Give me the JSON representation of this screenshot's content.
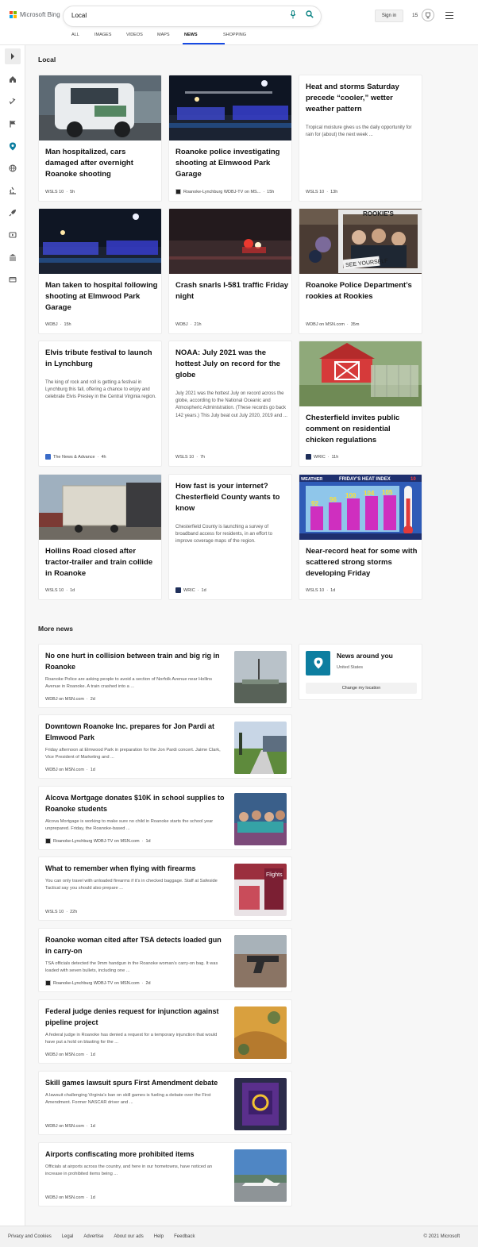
{
  "header": {
    "brand": "Microsoft Bing",
    "search_query": "Local",
    "sign_in": "Sign in",
    "points": "15",
    "tabs": [
      "ALL",
      "IMAGES",
      "VIDEOS",
      "MAPS",
      "NEWS",
      "SHOPPING"
    ],
    "active_tab": "NEWS",
    "accent_color": "#174ae4"
  },
  "sidebar": {
    "icons": [
      "expand-arrow-icon",
      "home-icon",
      "satellite-icon",
      "flag-icon",
      "location-pin-icon",
      "globe-icon",
      "microscope-icon",
      "rocket-icon",
      "video-icon",
      "bank-icon",
      "card-icon"
    ]
  },
  "local_section": {
    "title": "Local",
    "cards": [
      {
        "title": "Man hospitalized, cars damaged after overnight Roanoke shooting",
        "source": "WSLS 10",
        "age": "5h",
        "image": "police-car-photo"
      },
      {
        "title": "Roanoke police investigating shooting at Elmwood Park Garage",
        "source": "Roanoke-Lynchburg WDBJ-TV on MS...",
        "age": "15h",
        "image": "police-lights-night-photo"
      },
      {
        "title": "Heat and storms Saturday precede “cooler,” wetter weather pattern",
        "snippet": "Tropical moisture gives us the daily opportunity for rain for (about) the next week ...",
        "source": "WSLS 10",
        "age": "13h"
      },
      {
        "title": "Man taken to hospital following shooting at Elmwood Park Garage",
        "source": "WDBJ",
        "age": "15h",
        "image": "police-lights-night-photo"
      },
      {
        "title": "Crash snarls I-581 traffic Friday night",
        "source": "WDBJ",
        "age": "21h",
        "image": "highway-crash-night-photo"
      },
      {
        "title": "Roanoke Police Department’s rookies at Rookies",
        "source": "WDBJ on MSN.com",
        "age": "35m",
        "image": "rookies-frame-photo",
        "image_text": [
          "ROOKIE'S",
          "SEE YOURSELF"
        ]
      },
      {
        "title": "Elvis tribute festival to launch in Lynchburg",
        "snippet": "The king of rock and roll is getting a festival in Lynchburg this fall, offering a chance to enjoy and celebrate Elvis Presley in the Central Virginia region.",
        "source": "The News & Advance",
        "age": "4h"
      },
      {
        "title": "NOAA: July 2021 was the hottest July on record for the globe",
        "snippet": "July 2021 was the hottest July on record across the globe, according to the National Oceanic and Atmospheric Administration. (These records go back 142 years.) This July beat out July 2020, 2019 and ...",
        "source": "WSLS 10",
        "age": "7h"
      },
      {
        "title": "Chesterfield invites public comment on residential chicken regulations",
        "source": "WRIC",
        "age": "11h",
        "image": "red-chicken-coop-photo"
      },
      {
        "title": "Hollins Road closed after tractor-trailer and train collide in Roanoke",
        "source": "WSLS 10",
        "age": "1d",
        "image": "tractor-trailer-photo"
      },
      {
        "title": "How fast is your internet? Chesterfield County wants to know",
        "snippet": "Chesterfield County is launching a survey of broadband access for residents, in an effort to improve coverage maps of the region.",
        "source": "WRIC",
        "age": "1d"
      },
      {
        "title": "Near-record heat for some with scattered strong storms developing Friday",
        "source": "WSLS 10",
        "age": "1d",
        "image": "heat-index-graphic",
        "image_text": [
          "FRIDAY'S HEAT INDEX",
          "92",
          "96",
          "100",
          "104",
          "105",
          "WEATHER",
          "10"
        ]
      }
    ]
  },
  "more_news": {
    "title": "More news",
    "items": [
      {
        "title": "No one hurt in collision between train and big rig in Roanoke",
        "snippet": "Roanoke Police are asking people to avoid a section of Norfolk Avenue near Hollins Avenue in Roanoke. A train crashed into a ...",
        "source": "WDBJ on MSN.com",
        "age": "2d",
        "thumb": "overcast-road-photo"
      },
      {
        "title": "Downtown Roanoke Inc. prepares for Jon Pardi at Elmwood Park",
        "snippet": "Friday afternoon at Elmwood Park in preparation for the Jon Pardi concert. Jaime Clark, Vice President of Marketing and ...",
        "source": "WDBJ on MSN.com",
        "age": "1d",
        "thumb": "park-path-photo"
      },
      {
        "title": "Alcova Mortgage donates $10K in school supplies to Roanoke students",
        "snippet": "Alcova Mortgage is working to make sure no child in Roanoke starts the school year unprepared. Friday, the Roanoke-based ...",
        "source": "Roanoke-Lynchburg WDBJ-TV on MSN.com",
        "age": "1d",
        "thumb": "group-photo"
      },
      {
        "title": "What to remember when flying with firearms",
        "snippet": "You can only travel with unloaded firearms if it’s in checked baggage. Staff at Safeside Tactical say you should also prepare ...",
        "source": "WSLS 10",
        "age": "22h",
        "thumb": "airport-sign-photo",
        "thumb_text": "Flights"
      },
      {
        "title": "Roanoke woman cited after TSA detects loaded gun in carry-on",
        "snippet": "TSA officials detected the 9mm handgun in the Roanoke woman’s carry-on bag. It was loaded with seven bullets, including one ...",
        "source": "Roanoke-Lynchburg WDBJ-TV on MSN.com",
        "age": "2d",
        "thumb": "handgun-photo"
      },
      {
        "title": "Federal judge denies request for injunction against pipeline project",
        "snippet": "A federal judge in Roanoke has denied a request for a temporary injunction that would have put a hold on blasting for the ...",
        "source": "WDBJ on MSN.com",
        "age": "1d",
        "thumb": "construction-aerial-photo"
      },
      {
        "title": "Skill games lawsuit spurs First Amendment debate",
        "snippet": "A lawsuit challenging Virginia’s ban on skill games is fueling a debate over the First Amendment. Former NASCAR driver and ...",
        "source": "WDBJ on MSN.com",
        "age": "1d",
        "thumb": "skill-game-machine-photo"
      },
      {
        "title": "Airports confiscating more prohibited items",
        "snippet": "Officials at airports across the country, and here in our hometowns, have noticed an increase in prohibited items being ...",
        "source": "WDBJ on MSN.com",
        "age": "1d",
        "thumb": "airplane-photo"
      }
    ]
  },
  "news_around": {
    "title": "News around you",
    "location": "United States",
    "button": "Change my location",
    "pin_color": "#0d7ea0"
  },
  "footer": {
    "links": [
      "Privacy and Cookies",
      "Legal",
      "Advertise",
      "About our ads",
      "Help",
      "Feedback"
    ],
    "copyright": "© 2021 Microsoft"
  }
}
